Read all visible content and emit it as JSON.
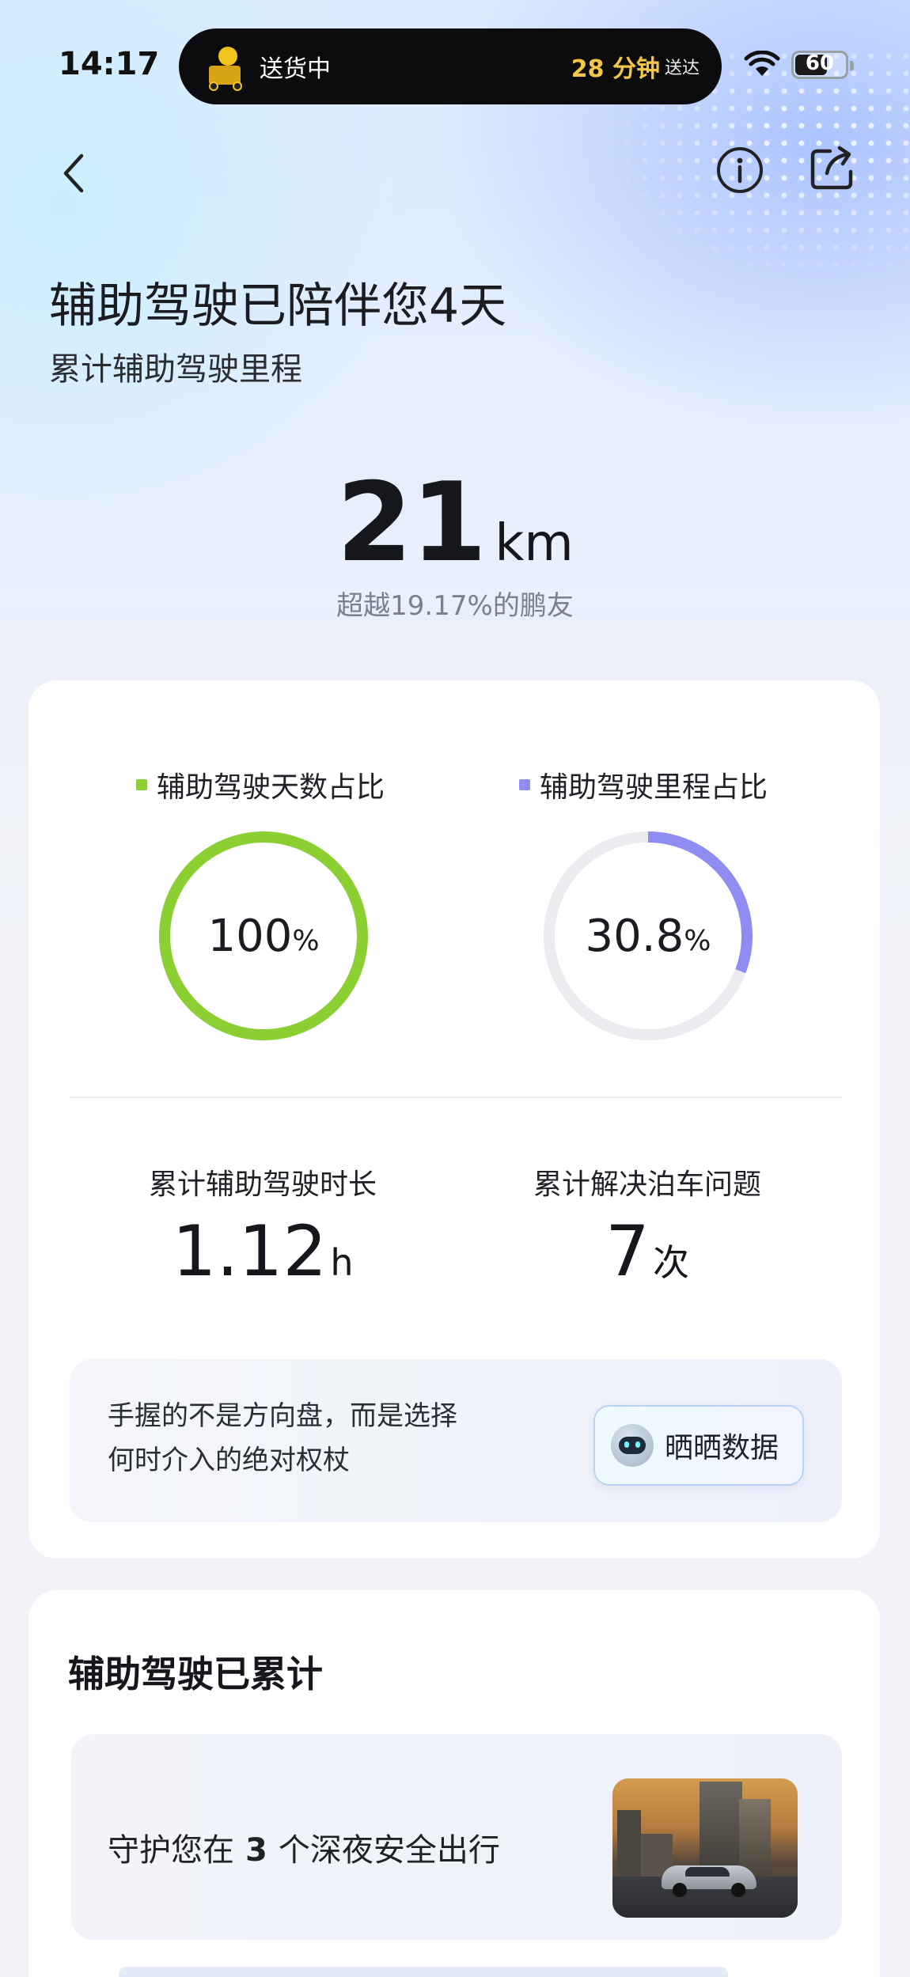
{
  "status_bar": {
    "time": "14:17",
    "live_activity": {
      "status": "送货中",
      "eta": "28 分钟",
      "eta_suffix": "送达"
    },
    "battery": "60"
  },
  "nav": {
    "back_icon": "chevron-left-icon",
    "info_icon": "info-circle-icon",
    "share_icon": "share-icon"
  },
  "header": {
    "title": "辅助驾驶已陪伴您4天",
    "subtitle": "累计辅助驾驶里程",
    "mileage_value": "21",
    "mileage_unit": "km",
    "beat_text": "超越19.17%的鹏友"
  },
  "stats_card": {
    "days_ratio": {
      "label": "辅助驾驶天数占比",
      "value": "100",
      "unit": "%",
      "fraction": 1.0,
      "color": "#8ccf33"
    },
    "mileage_ratio": {
      "label": "辅助驾驶里程占比",
      "value": "30.8",
      "unit": "%",
      "fraction": 0.308,
      "color": "#8f8cf2"
    },
    "duration": {
      "label": "累计辅助驾驶时长",
      "value": "1.12",
      "unit": "h"
    },
    "parking": {
      "label": "累计解决泊车问题",
      "value": "7",
      "unit": "次"
    },
    "quote_line1": "手握的不是方向盘，而是选择",
    "quote_line2": "何时介入的绝对权杖",
    "share_button": "晒晒数据"
  },
  "accumulated": {
    "title": "辅助驾驶已累计",
    "night_prefix": "守护您在",
    "night_count": "3",
    "night_suffix": "个深夜安全出行"
  },
  "colors": {
    "track": "#ececf0",
    "green": "#8ccf33",
    "purple": "#8f8cf2"
  }
}
